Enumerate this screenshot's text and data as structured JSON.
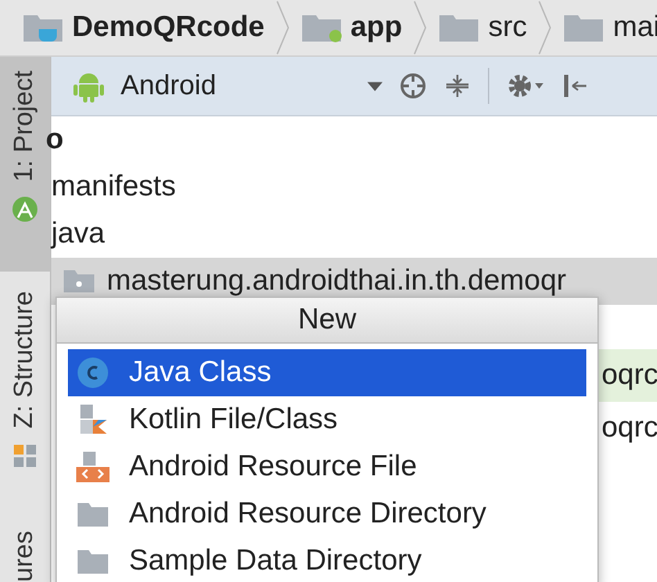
{
  "breadcrumbs": [
    {
      "label": "DemoQRcode",
      "kind": "project"
    },
    {
      "label": "app",
      "kind": "module"
    },
    {
      "label": "src",
      "kind": "folder"
    },
    {
      "label": "mai",
      "kind": "folder"
    }
  ],
  "side_tabs": [
    {
      "label": "1: Project",
      "selected": true
    },
    {
      "label": "Z: Structure",
      "selected": false
    },
    {
      "label": "ures",
      "selected": false
    }
  ],
  "toolbar": {
    "view": "Android"
  },
  "tree": [
    {
      "label": "o",
      "kind": "bold"
    },
    {
      "label": "manifests",
      "kind": "plain"
    },
    {
      "label": "java",
      "kind": "plain"
    },
    {
      "label": "masterung.androidthai.in.th.demoqr",
      "kind": "package"
    }
  ],
  "behind_popup": [
    {
      "label": "oqrc",
      "selected": true
    },
    {
      "label": "oqrc",
      "selected": false
    }
  ],
  "popup": {
    "title": "New",
    "items": [
      {
        "label": "Java Class",
        "kind": "java",
        "selected": true
      },
      {
        "label": "Kotlin File/Class",
        "kind": "kotlin",
        "selected": false
      },
      {
        "label": "Android Resource File",
        "kind": "resfile",
        "selected": false
      },
      {
        "label": "Android Resource Directory",
        "kind": "folder",
        "selected": false
      },
      {
        "label": "Sample Data Directory",
        "kind": "folder",
        "selected": false
      }
    ]
  }
}
